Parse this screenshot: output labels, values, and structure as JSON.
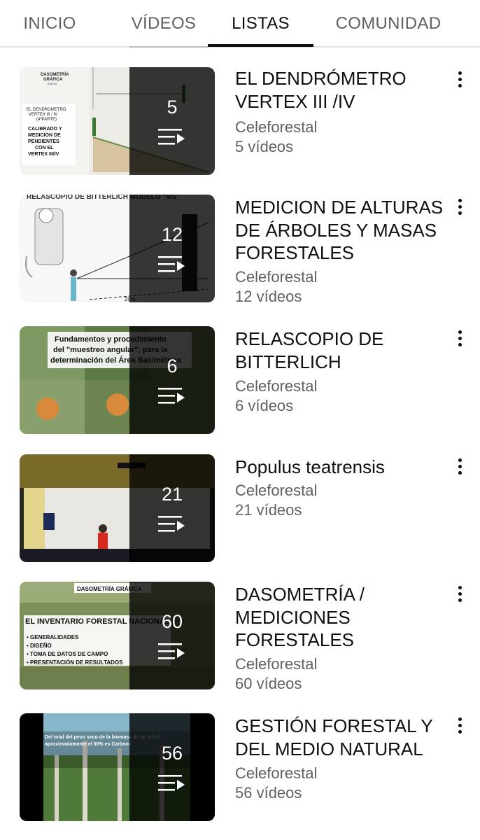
{
  "tabs": [
    {
      "label": "INICIO",
      "active": false
    },
    {
      "label": "VÍDEOS",
      "active": false
    },
    {
      "label": "LISTAS",
      "active": true
    },
    {
      "label": "COMUNIDAD",
      "active": false
    }
  ],
  "playlists": [
    {
      "title": "EL DENDRÓMETRO VERTEX III /IV",
      "channel": "Celeforestal",
      "videos_label": "5 vídeos",
      "count": "5",
      "thumb_text": {
        "header": "DASOMETRÍA\nGRÁFICA\nANEXO",
        "subheader": "EL DENDROMETRO\nVERTEX III / IV\n(4ªPARTE)",
        "body": "CALIBRADO Y\nMEDICIÓN DE\nPENDIENTES\nCON EL\nVERTEX III/IV"
      }
    },
    {
      "title": "MEDICION DE ALTURAS DE ÁRBOLES Y MASAS FORESTALES",
      "channel": "Celeforestal",
      "videos_label": "12 vídeos",
      "count": "12",
      "thumb_text": {
        "header": "RELASCOPIO DE BITTERLICH MODELO \"MS\""
      }
    },
    {
      "title": "RELASCOPIO DE BITTERLICH",
      "channel": "Celeforestal",
      "videos_label": "6 vídeos",
      "count": "6",
      "thumb_text": {
        "header": "Fundamentos y procedimiento\ndel \"muestreo angular\", para la\ndeterminación del Área Basimétrica"
      }
    },
    {
      "title": "Populus teatrensis",
      "channel": "Celeforestal",
      "videos_label": "21 vídeos",
      "count": "21"
    },
    {
      "title": "DASOMETRÍA / MEDICIONES FORESTALES",
      "channel": "Celeforestal",
      "videos_label": "60 vídeos",
      "count": "60",
      "thumb_text": {
        "header": "DASOMETRÍA GRÁFICA",
        "subheader": "EL INVENTARIO FORESTAL NACIONAL",
        "body": "• GENERALIDADES\n• DISEÑO\n• TOMA DE DATOS DE CAMPO\n• PRESENTACIÓN DE RESULTADOS"
      }
    },
    {
      "title": "GESTIÓN FORESTAL Y DEL MEDIO NATURAL",
      "channel": "Celeforestal",
      "videos_label": "56 vídeos",
      "count": "56",
      "thumb_text": {
        "header": "Del total del peso seco de la biomasa de un árbol, aproximadamente el 50% es Carbono"
      }
    }
  ],
  "colors": {
    "accent": "#0f0f0f",
    "secondary_text": "#606060",
    "overlay": "#000000"
  },
  "icons": {
    "playlist": "playlist-play-icon",
    "menu": "more-vert-icon"
  }
}
